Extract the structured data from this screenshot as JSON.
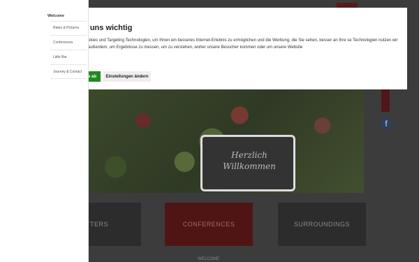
{
  "menu": {
    "title": "Welcome",
    "items": [
      {
        "label": "Rates & Pictures"
      },
      {
        "label": "Conferences"
      },
      {
        "label": "Little Bar"
      },
      {
        "label": "Journey & Contact"
      }
    ]
  },
  "cookie": {
    "title": "st uns wichtig",
    "text": "okies und Targeting Technologien, um Ihnen ein besseres Internet-Erlebnis zu ermöglichen und die Werbung, die Sie sehen, besser an Ihre se Technologien nutzen wir außerdem, um Ergebnisse zu messen, um zu verstehen, woher unsere Besucher kommen oder um unsere Website",
    "accept_label": "e ab",
    "settings_label": "Einstellungen ändern",
    "accept_color": "#1f8a1f"
  },
  "hero": {
    "chalk_text": "Herzlich Willkommen"
  },
  "tiles": [
    {
      "label": "TTERS"
    },
    {
      "label": "CONFERENCES"
    },
    {
      "label": "SURROUNDINGS"
    }
  ],
  "bottom_hint": "WELCOME",
  "icons": {
    "facebook": "f"
  },
  "colors": {
    "brand_red": "#4f1515"
  }
}
